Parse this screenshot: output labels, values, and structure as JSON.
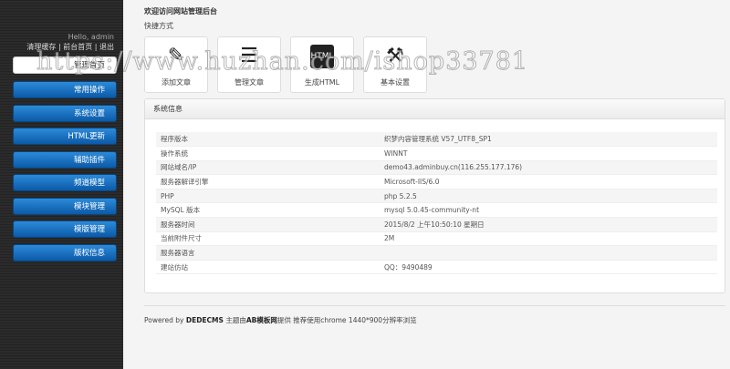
{
  "sidebar": {
    "greeting": "Hello, admin",
    "links": [
      "清理缓存",
      "前台首页",
      "退出"
    ],
    "sep": "|",
    "home": "管理首页",
    "items": [
      "常用操作",
      "系统设置",
      "HTML更新",
      "辅助插件",
      "频道模型",
      "模块管理",
      "模版管理",
      "版权信息"
    ]
  },
  "main": {
    "title": "欢迎访问网站管理后台",
    "shortcuts_title": "快捷方式",
    "shortcuts": [
      {
        "label": "添加文章",
        "icon": "pencil-icon"
      },
      {
        "label": "管理文章",
        "icon": "stack-icon"
      },
      {
        "label": "生成HTML",
        "icon": "html-icon"
      },
      {
        "label": "基本设置",
        "icon": "tools-icon"
      }
    ],
    "panel_title": "系统信息",
    "rows": [
      [
        "程序版本",
        "织梦内容管理系统 V57_UTF8_SP1"
      ],
      [
        "操作系统",
        "WINNT"
      ],
      [
        "网站域名/IP",
        "demo43.adminbuy.cn(116.255.177.176)"
      ],
      [
        "服务器解译引擎",
        "Microsoft-IIS/6.0"
      ],
      [
        "PHP",
        "php 5.2.5"
      ],
      [
        "MySQL 版本",
        "mysql 5.0.45-community-nt"
      ],
      [
        "服务器时间",
        "2015/8/2 上午10:50:10 星期日"
      ],
      [
        "当前附件尺寸",
        "2M"
      ],
      [
        "服务器语言",
        ""
      ],
      [
        "建站仿站",
        "QQ：9490489"
      ]
    ]
  },
  "footer": {
    "pre": "Powered by ",
    "brand": "DEDECMS",
    "mid": " 主题由",
    "brand2": "AB模板网",
    "post": "提供 推荐使用chrome 1440*900分辨率浏览"
  },
  "watermark": "https://www.huzhan.com/ishop33781"
}
